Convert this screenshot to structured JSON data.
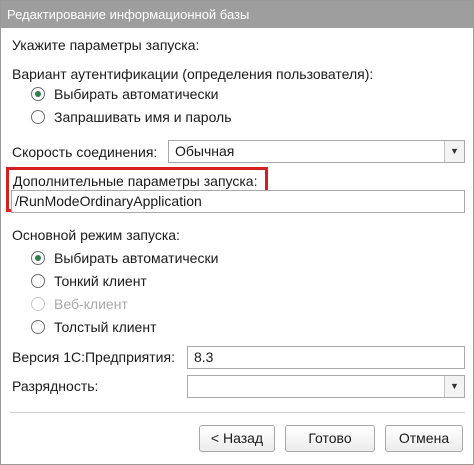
{
  "window": {
    "title": "Редактирование информационной базы"
  },
  "launch_params": {
    "heading": "Укажите параметры запуска:"
  },
  "auth": {
    "label": "Вариант аутентификации (определения пользователя):",
    "options": [
      {
        "label": "Выбирать автоматически",
        "selected": true
      },
      {
        "label": "Запрашивать имя и пароль",
        "selected": false
      }
    ]
  },
  "speed": {
    "label": "Скорость соединения:",
    "value": "Обычная"
  },
  "extra": {
    "label": "Дополнительные параметры запуска:",
    "value": "/RunModeOrdinaryApplication",
    "highlight_color": "#d42020"
  },
  "mode": {
    "label": "Основной режим запуска:",
    "options": [
      {
        "label": "Выбирать автоматически",
        "selected": true,
        "enabled": true
      },
      {
        "label": "Тонкий клиент",
        "selected": false,
        "enabled": true
      },
      {
        "label": "Веб-клиент",
        "selected": false,
        "enabled": false
      },
      {
        "label": "Толстый клиент",
        "selected": false,
        "enabled": true
      }
    ]
  },
  "version": {
    "label": "Версия 1С:Предприятия:",
    "value": "8.3"
  },
  "bitness": {
    "label": "Разрядность:",
    "value": ""
  },
  "buttons": {
    "back": "< Назад",
    "done": "Готово",
    "cancel": "Отмена"
  },
  "icons": {
    "dropdown": "chevron-down-icon"
  }
}
